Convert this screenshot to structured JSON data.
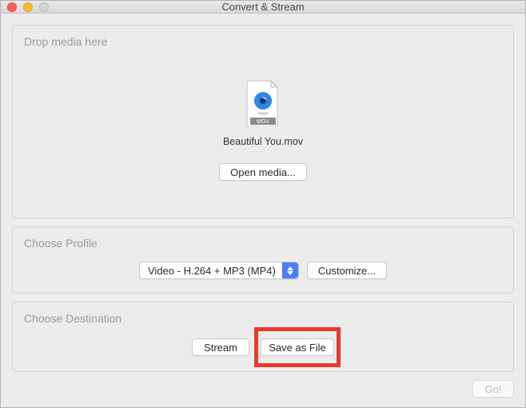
{
  "window": {
    "title": "Convert & Stream"
  },
  "drop": {
    "label": "Drop media here",
    "filename": "Beautiful You.mov",
    "filetype_badge": "MOV",
    "open_button": "Open media..."
  },
  "profile": {
    "label": "Choose Profile",
    "selected": "Video - H.264 + MP3 (MP4)",
    "customize_button": "Customize..."
  },
  "destination": {
    "label": "Choose Destination",
    "stream_button": "Stream",
    "save_button": "Save as File"
  },
  "footer": {
    "go_button": "Go!"
  },
  "colors": {
    "highlight": "#e63a2e",
    "accent_blue": "#4a7ff8"
  }
}
